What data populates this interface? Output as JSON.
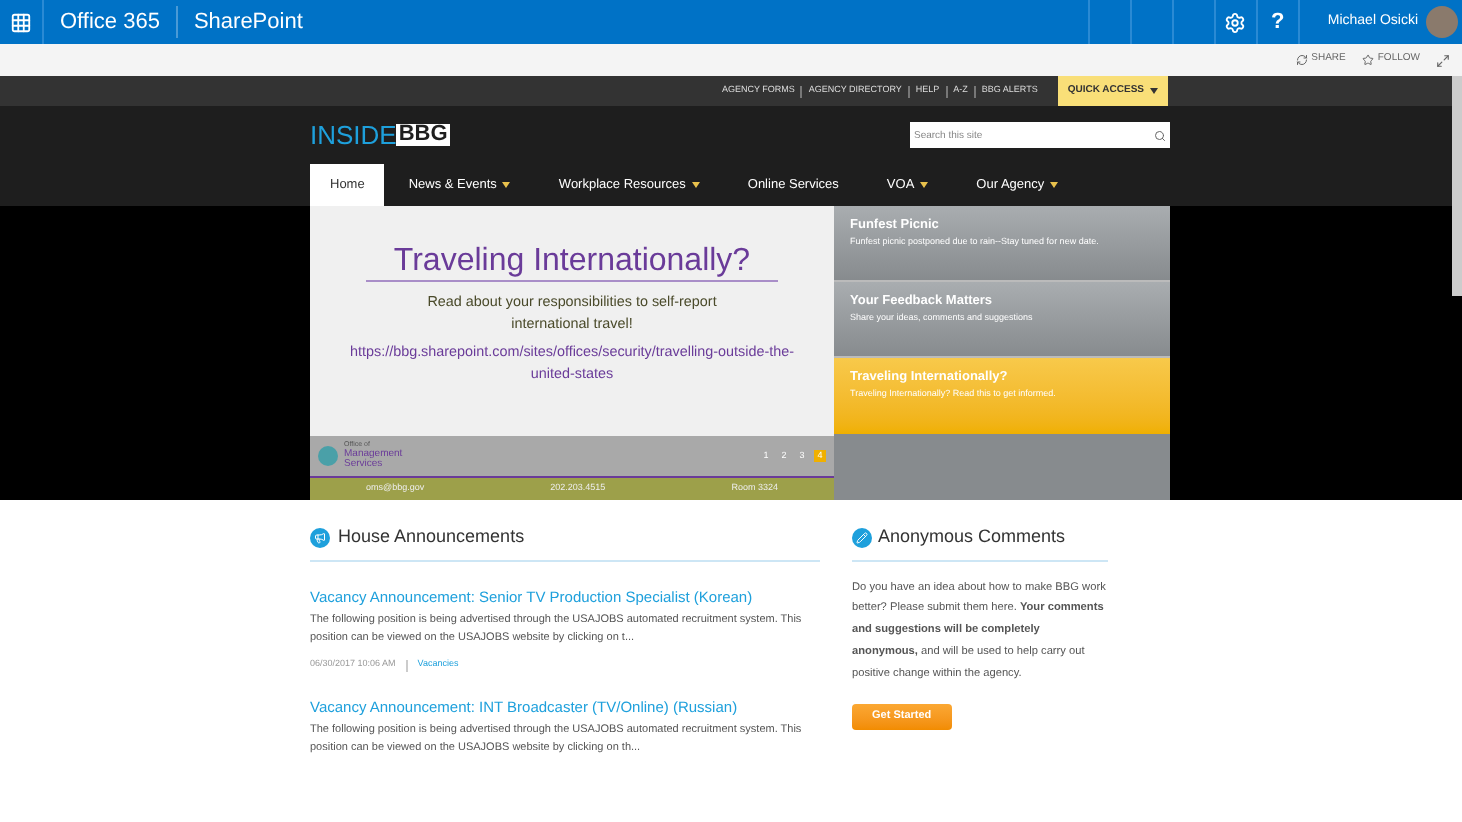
{
  "suite_bar": {
    "brand": "Office 365",
    "app": "SharePoint",
    "help": "?",
    "user": "Michael Osicki"
  },
  "page_actions": [
    "SHARE",
    "FOLLOW"
  ],
  "utility_links": [
    "AGENCY FORMS",
    "AGENCY DIRECTORY",
    "HELP",
    "A-Z",
    "BBG ALERTS"
  ],
  "quick_access": "QUICK ACCESS",
  "logo": {
    "left": "INSIDE",
    "right": "BBG"
  },
  "search": {
    "placeholder": "Search this site"
  },
  "nav": [
    {
      "label": "Home",
      "selected": true,
      "dropdown": false
    },
    {
      "label": "News & Events",
      "selected": false,
      "dropdown": true
    },
    {
      "label": "Workplace Resources",
      "selected": false,
      "dropdown": true
    },
    {
      "label": "Online Services",
      "selected": false,
      "dropdown": false
    },
    {
      "label": "VOA",
      "selected": false,
      "dropdown": true
    },
    {
      "label": "Our Agency",
      "selected": false,
      "dropdown": true
    }
  ],
  "slide": {
    "title": "Traveling Internationally?",
    "body": "Read about your responsibilities to self-report international travel!",
    "link": "https://bbg.sharepoint.com/sites/offices/security/travelling-outside-the-united-states",
    "org": [
      "Office of",
      "Management",
      "Services"
    ],
    "footer": [
      "oms@bbg.gov",
      "202.203.4515",
      "Room 3324"
    ]
  },
  "pager": [
    {
      "label": "1",
      "selected": false
    },
    {
      "label": "2",
      "selected": false
    },
    {
      "label": "3",
      "selected": false
    },
    {
      "label": "4",
      "selected": true
    }
  ],
  "carousel_items": [
    {
      "title": "Funfest Picnic",
      "text": "Funfest picnic postponed due to rain--Stay tuned for new date.",
      "selected": false
    },
    {
      "title": "Your Feedback Matters",
      "text": "Share your ideas, comments and suggestions",
      "selected": false
    },
    {
      "title": "Traveling Internationally?",
      "text": "Traveling Internationally? Read this to get informed.",
      "selected": true
    }
  ],
  "announcements": {
    "title": "House Announcements",
    "items": [
      {
        "title": "Vacancy Announcement: Senior TV Production Specialist (Korean)",
        "text": "The following position is being advertised through the USAJOBS automated recruitment system.  This position can be viewed on the USAJOBS website by clicking on t...",
        "date": "06/30/2017 10:06 AM",
        "category": "Vacancies"
      },
      {
        "title": "Vacancy Announcement: INT Broadcaster (TV/Online) (Russian)",
        "text": "The following position is being advertised through the USAJOBS automated recruitment system.  This position can be viewed on the USAJOBS website by clicking on th..."
      }
    ]
  },
  "comments": {
    "title": "Anonymous Comments",
    "text": "Do you have an idea about how to make BBG work better? Please submit them here. **Your comments and suggestions will be completely anonymous,** and will be used to help carry out positive change within the agency.",
    "button": "Get Started"
  }
}
